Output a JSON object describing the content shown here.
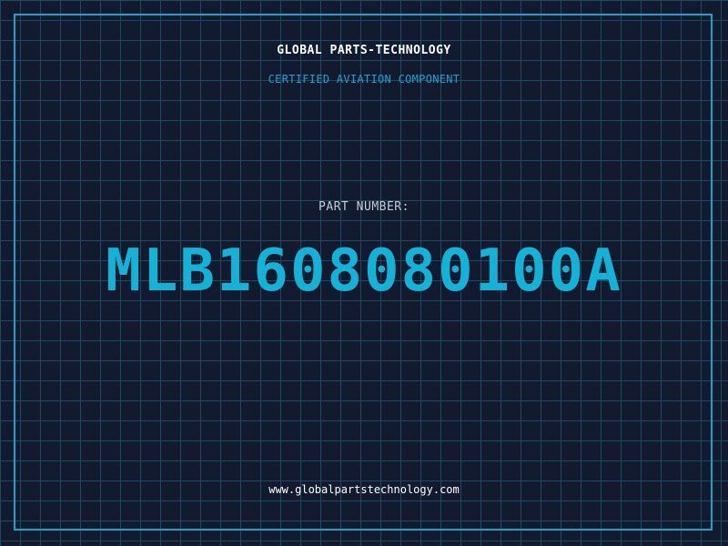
{
  "brand": "GLOBAL PARTS-TECHNOLOGY",
  "subtitle": "CERTIFIED AVIATION COMPONENT",
  "part_label": "PART NUMBER:",
  "part_number": "MLB1608080100A",
  "website": "www.globalpartstechnology.com",
  "colors": {
    "background": "#111a2e",
    "grid": "#1d4a5e",
    "accent": "#13b3d8",
    "text": "#ffffff",
    "muted": "#c6ccd6"
  }
}
